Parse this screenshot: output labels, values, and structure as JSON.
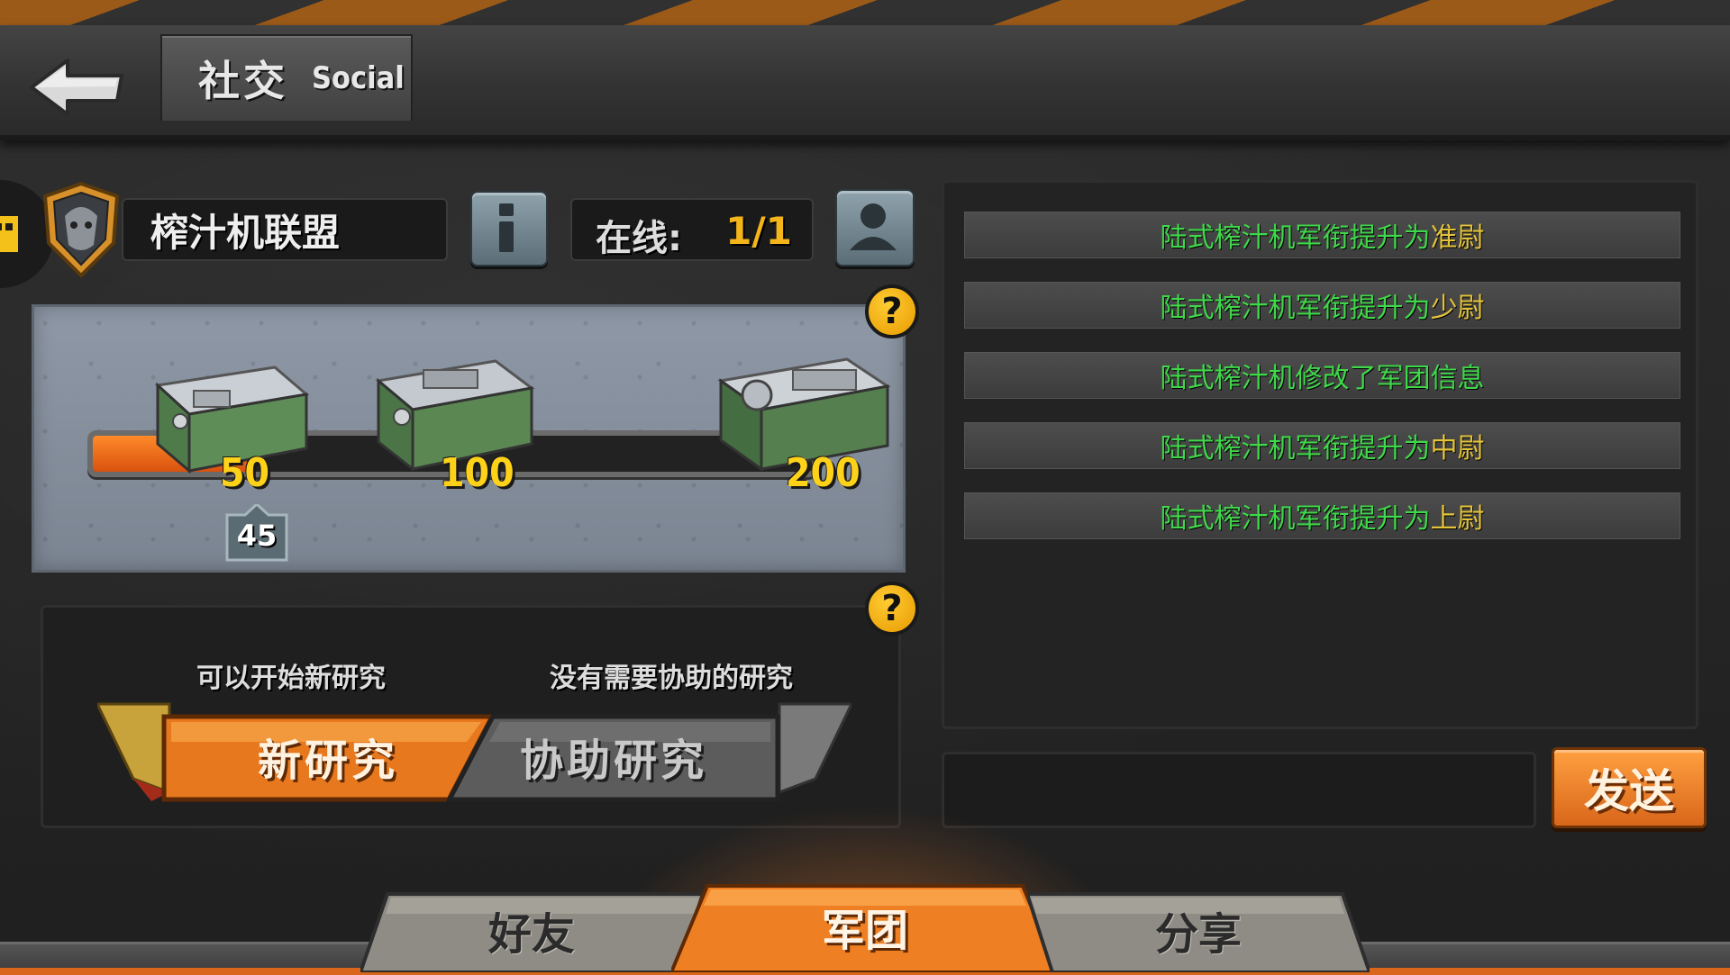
{
  "header": {
    "title_cn": "社交",
    "title_en": "Social",
    "back_icon": "back-arrow-icon"
  },
  "guild": {
    "name": "榨汁机联盟",
    "online_label": "在线:",
    "online_value": "1/1",
    "info_icon": "info-icon",
    "members_icon": "person-icon"
  },
  "progress": {
    "current": 45,
    "current_label": "45",
    "max": 200,
    "milestones": [
      {
        "value": 50,
        "label": "50"
      },
      {
        "value": 100,
        "label": "100"
      },
      {
        "value": 200,
        "label": "200"
      }
    ],
    "help_icon": "question-icon"
  },
  "research": {
    "new_caption": "可以开始新研究",
    "assist_caption": "没有需要协助的研究",
    "new_button": "新研究",
    "assist_button": "协助研究"
  },
  "messages": [
    {
      "name": "陆式榨汁机",
      "action": "军衔提升为",
      "rank": "准尉"
    },
    {
      "name": "陆式榨汁机",
      "action": "军衔提升为",
      "rank": "少尉"
    },
    {
      "name": "陆式榨汁机",
      "action": "修改了军团信息",
      "rank": ""
    },
    {
      "name": "陆式榨汁机",
      "action": "军衔提升为",
      "rank": "中尉"
    },
    {
      "name": "陆式榨汁机",
      "action": "军衔提升为",
      "rank": "上尉"
    }
  ],
  "chat": {
    "input_value": "",
    "send_button": "发送"
  },
  "tabs": [
    {
      "label": "好友",
      "active": false
    },
    {
      "label": "军团",
      "active": true
    },
    {
      "label": "分享",
      "active": false
    }
  ],
  "colors": {
    "accent_orange": "#e8781e",
    "message_green": "#3fd84a",
    "rank_yellow": "#e3c33a",
    "milestone_yellow": "#ffd21a"
  }
}
